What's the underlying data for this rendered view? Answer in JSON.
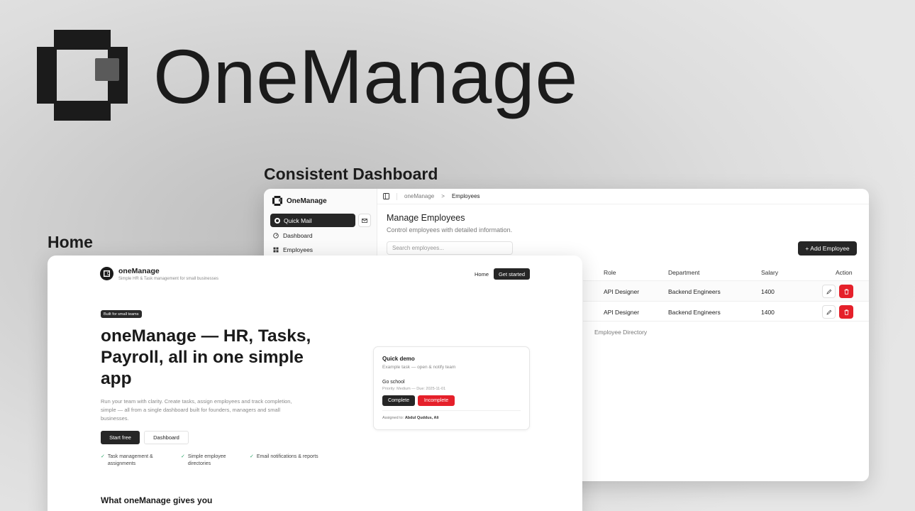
{
  "brand": {
    "name": "OneManage"
  },
  "sections": {
    "dashboard_label": "Consistent Dashboard",
    "home_label": "Home"
  },
  "dashboard": {
    "brand": "OneManage",
    "sidebar": {
      "quick_mail": "Quick Mail",
      "items": [
        {
          "label": "Dashboard",
          "icon": "gauge-icon"
        },
        {
          "label": "Employees",
          "icon": "grid-icon"
        }
      ]
    },
    "breadcrumb": {
      "root": "oneManage",
      "separator": ">",
      "current": "Employees"
    },
    "title": "Manage Employees",
    "subtitle": "Control employees with detailed information.",
    "search_placeholder": "Search employees...",
    "add_button": "+ Add Employee",
    "table": {
      "headers": [
        "Role",
        "Department",
        "Salary",
        "Action"
      ],
      "rows": [
        {
          "role": "API Designer",
          "department": "Backend Engineers",
          "salary": "1400"
        },
        {
          "role": "API Designer",
          "department": "Backend Engineers",
          "salary": "1400"
        }
      ]
    },
    "caption": "Employee Directory",
    "colors": {
      "primary": "#262626",
      "danger": "#e5202a"
    }
  },
  "home": {
    "brand": "oneManage",
    "tagline": "Simple HR & Task management for small businesses",
    "nav": {
      "home": "Home",
      "cta": "Get started"
    },
    "badge": "Built for small teams",
    "headline": "oneManage — HR, Tasks, Payroll, all in one simple app",
    "description": "Run your team with clarity. Create tasks, assign employees and track completion, simple — all from a single dashboard built for founders, managers and small businesses.",
    "buttons": {
      "start": "Start free",
      "dashboard": "Dashboard"
    },
    "features": [
      "Task management & assignments",
      "Simple employee directories",
      "Email notifications & reports"
    ],
    "check_glyph": "✓",
    "section_title": "What oneManage gives you",
    "demo": {
      "title": "Quick demo",
      "subtitle": "Example task — open & notify team",
      "task": "Go school",
      "meta": "Priority: Medium — Due: 2025-11-01",
      "complete": "Complete",
      "incomplete": "Incomplete",
      "assigned_label": "Assigned to:",
      "assigned_names": "Abdul Quddus, Ali"
    }
  }
}
